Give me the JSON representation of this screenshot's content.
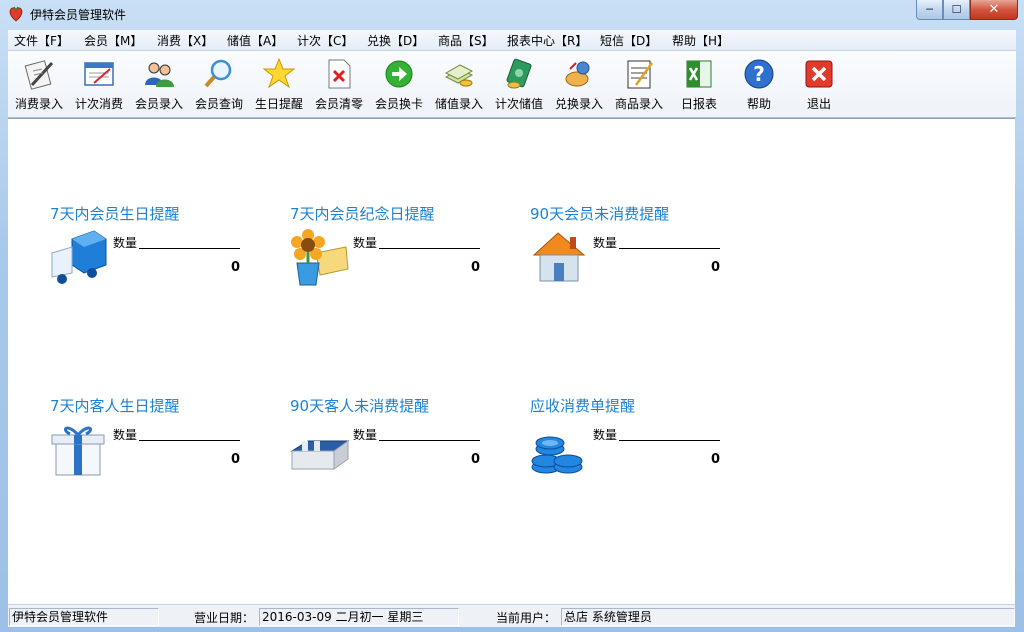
{
  "window": {
    "title": "伊特会员管理软件"
  },
  "menu": [
    {
      "label": "文件【F】"
    },
    {
      "label": "会员【M】"
    },
    {
      "label": "消费【X】"
    },
    {
      "label": "储值【A】"
    },
    {
      "label": "计次【C】"
    },
    {
      "label": "兑换【D】"
    },
    {
      "label": "商品【S】"
    },
    {
      "label": "报表中心【R】"
    },
    {
      "label": "短信【D】"
    },
    {
      "label": "帮助【H】"
    }
  ],
  "toolbar": [
    {
      "label": "消费录入",
      "icon": "pen-paper-icon"
    },
    {
      "label": "计次消费",
      "icon": "card-icon"
    },
    {
      "label": "会员录入",
      "icon": "users-icon"
    },
    {
      "label": "会员查询",
      "icon": "magnifier-icon"
    },
    {
      "label": "生日提醒",
      "icon": "star-icon"
    },
    {
      "label": "会员清零",
      "icon": "document-x-icon"
    },
    {
      "label": "会员换卡",
      "icon": "green-arrow-icon"
    },
    {
      "label": "储值录入",
      "icon": "money-icon"
    },
    {
      "label": "计次储值",
      "icon": "money-stack-icon"
    },
    {
      "label": "兑换录入",
      "icon": "exchange-icon"
    },
    {
      "label": "商品录入",
      "icon": "notepad-icon"
    },
    {
      "label": "日报表",
      "icon": "excel-icon"
    },
    {
      "label": "帮助",
      "icon": "help-icon"
    },
    {
      "label": "退出",
      "icon": "exit-icon"
    }
  ],
  "reminders": [
    {
      "title": "7天内会员生日提醒",
      "count_label": "数量",
      "count": "0",
      "icon": "delivery-truck-icon"
    },
    {
      "title": "7天内会员纪念日提醒",
      "count_label": "数量",
      "count": "0",
      "icon": "flower-icon"
    },
    {
      "title": "90天会员未消费提醒",
      "count_label": "数量",
      "count": "0",
      "icon": "house-icon"
    },
    {
      "title": "7天内客人生日提醒",
      "count_label": "数量",
      "count": "0",
      "icon": "gift-box-icon"
    },
    {
      "title": "90天客人未消费提醒",
      "count_label": "数量",
      "count": "0",
      "icon": "package-icon"
    },
    {
      "title": "应收消费单提醒",
      "count_label": "数量",
      "count": "0",
      "icon": "coins-icon"
    }
  ],
  "status": {
    "app_name": "伊特会员管理软件",
    "business_date_label": "营业日期：",
    "business_date": "2016-03-09   二月初一   星期三",
    "user_label": "当前用户：",
    "user": "总店 系统管理员"
  },
  "colors": {
    "link": "#1e82d2",
    "title_bar": "#a9c9ea"
  }
}
